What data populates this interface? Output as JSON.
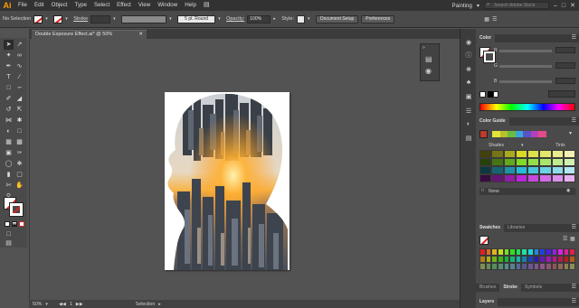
{
  "app": {
    "logo_text": "Ai",
    "menus": [
      "File",
      "Edit",
      "Object",
      "Type",
      "Select",
      "Effect",
      "View",
      "Window",
      "Help"
    ],
    "workspace_label": "Painting",
    "search_placeholder": "Search Adobe Stock",
    "window_controls": [
      "–",
      "□",
      "✕"
    ]
  },
  "control_bar": {
    "selection_label": "No Selection",
    "stroke_label": "Stroke",
    "brush_label": "5 pt. Round",
    "opacity_label": "Opacity:",
    "opacity_value": "100%",
    "style_label": "Style:",
    "document_setup_label": "Document Setup",
    "preferences_label": "Preferences"
  },
  "document": {
    "tab_title": "Double Exposure Effect.ai* @ 50% (RGB/Preview)",
    "close_glyph": "✕"
  },
  "status_bar": {
    "zoom": "50%",
    "page": "1",
    "mode": "Selection"
  },
  "panels": {
    "color": {
      "tab": "Color",
      "channels": [
        "R",
        "G",
        "B"
      ]
    },
    "color_guide": {
      "tab": "Color Guide",
      "shades_label": "Shades",
      "tints_label": "Tints",
      "none_label": "None"
    },
    "swatches": {
      "tabs": [
        "Swatches",
        "Libraries"
      ]
    },
    "stroke": {
      "tabs": [
        "Brushes",
        "Stroke",
        "Symbols"
      ]
    },
    "layers": {
      "tab": "Layers"
    }
  },
  "colors": {
    "accent_logo": "#ff9a00",
    "fill_none_slash": "#e02020",
    "app_bg": "#535353",
    "menubar_bg": "#323232"
  }
}
